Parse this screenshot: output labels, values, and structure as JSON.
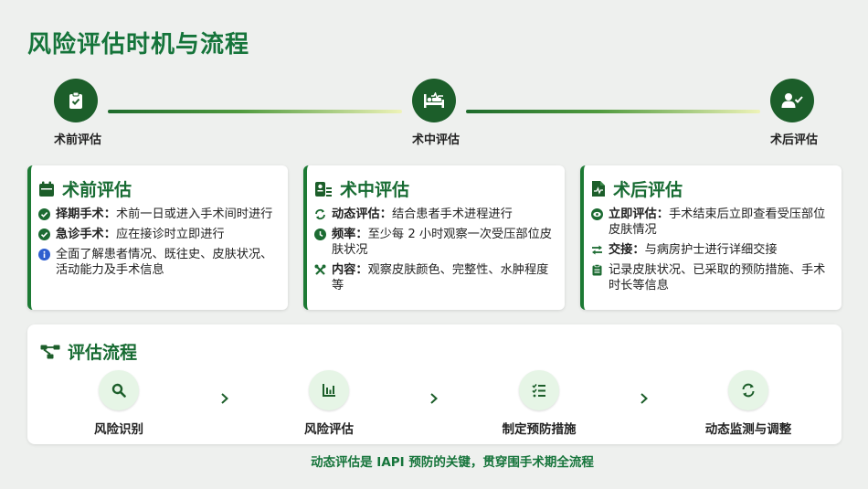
{
  "page": {
    "title": "风险评估时机与流程"
  },
  "timeline": {
    "stages": [
      {
        "label": "术前评估",
        "icon": "clipboard-check-icon"
      },
      {
        "label": "术中评估",
        "icon": "bed-pulse-icon"
      },
      {
        "label": "术后评估",
        "icon": "user-check-icon"
      }
    ]
  },
  "cards": [
    {
      "title": "术前评估",
      "icon": "calendar-icon",
      "items": [
        {
          "icon": "check-circle-icon",
          "label": "择期手术：",
          "text": "术前一日或进入手术间时进行"
        },
        {
          "icon": "check-circle-icon",
          "label": "急诊手术：",
          "text": "应在接诊时立即进行"
        },
        {
          "icon": "info-circle-icon",
          "label": "",
          "text": "全面了解患者情况、既往史、皮肤状况、活动能力及手术信息"
        }
      ]
    },
    {
      "title": "术中评估",
      "icon": "id-badge-icon",
      "items": [
        {
          "icon": "sync-icon",
          "label": "动态评估：",
          "text": "结合患者手术进程进行"
        },
        {
          "icon": "clock-icon",
          "label": "频率：",
          "text": "至少每 2 小时观察一次受压部位皮肤状况"
        },
        {
          "icon": "tools-icon",
          "label": "内容：",
          "text": "观察皮肤颜色、完整性、水肿程度等"
        }
      ]
    },
    {
      "title": "术后评估",
      "icon": "file-medical-icon",
      "items": [
        {
          "icon": "eye-icon",
          "label": "立即评估：",
          "text": "手术结束后立即查看受压部位皮肤情况"
        },
        {
          "icon": "exchange-icon",
          "label": "交接：",
          "text": "与病房护士进行详细交接"
        },
        {
          "icon": "clipboard-icon",
          "label": "",
          "text": "记录皮肤状况、已采取的预防措施、手术时长等信息"
        }
      ]
    }
  ],
  "flow": {
    "title": "评估流程",
    "icon": "project-diagram-icon",
    "steps": [
      {
        "label": "风险识别",
        "icon": "search-icon"
      },
      {
        "label": "风险评估",
        "icon": "chart-bar-icon"
      },
      {
        "label": "制定预防措施",
        "icon": "tasks-icon"
      },
      {
        "label": "动态监测与调整",
        "icon": "refresh-icon"
      }
    ]
  },
  "footer": {
    "note": "动态评估是 IAPI 预防的关键，贯穿围手术期全流程"
  },
  "colors": {
    "primary": "#1c5e2a",
    "accent": "#176b32",
    "background": "#eef0ee"
  }
}
